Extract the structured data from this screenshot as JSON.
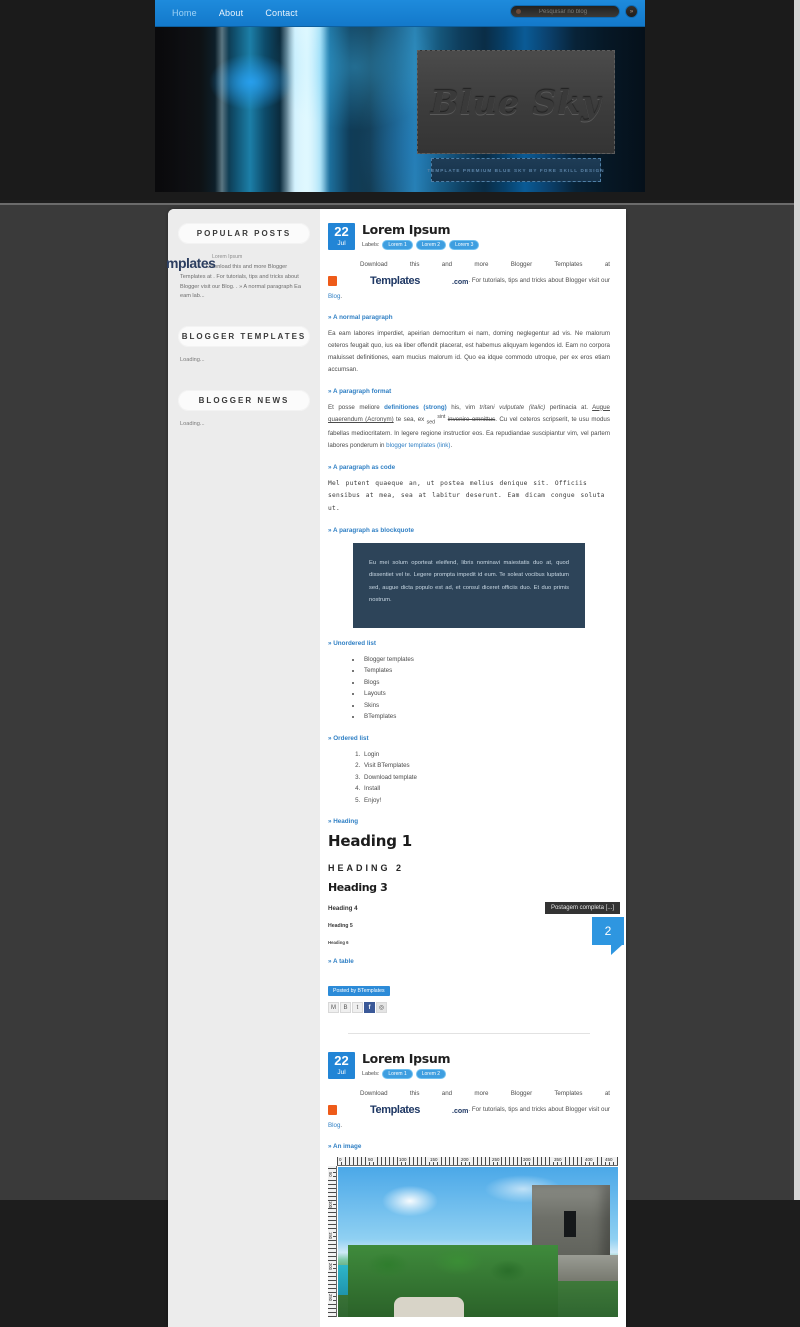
{
  "nav": {
    "items": [
      {
        "label": "Home",
        "active": true
      },
      {
        "label": "About",
        "active": false
      },
      {
        "label": "Contact",
        "active": false
      }
    ],
    "search": {
      "placeholder": "Pesquisar no blog",
      "value": "",
      "go_label": "»"
    }
  },
  "header": {
    "logo_text": "Blue Sky",
    "tagline": "TEMPLATE PREMIUM BLUE SKY BY FORE SKILL DESIGN"
  },
  "sidebar": {
    "widgets": [
      {
        "title": "POPULAR POSTS",
        "type": "popular",
        "watermark": "mplates",
        "item_title": "Lorem Ipsum",
        "item_snippet": "Download this and more Blogger Templates at . For tutorials, tips and tricks about Blogger visit our Blog. . » A normal paragraph Ea eam lab..."
      },
      {
        "title": "BLOGGER TEMPLATES",
        "type": "loading",
        "body": "Loading..."
      },
      {
        "title": "BLOGGER NEWS",
        "type": "loading",
        "body": "Loading..."
      }
    ]
  },
  "posts": [
    {
      "date_day": "22",
      "date_month": "Jul",
      "title": "Lorem Ipsum",
      "labels_word": "Labels:",
      "labels": [
        "Lorem 1",
        "Lorem 2",
        "Lorem 3"
      ],
      "intro_before": "Download this and more Blogger Templates at ",
      "intro_after_1": ". For tutorials, tips and tricks about Blogger visit our ",
      "intro_link": "Blog",
      "intro_end": ".",
      "btemplates": {
        "b": "B",
        "word": "Templates",
        "com": ".com"
      },
      "sections": {
        "normal_paragraph": "» A normal paragraph",
        "normal_paragraph_text": "Ea eam labores imperdiet, apeirian democritum ei nam, doming neglegentur ad vis. Ne malorum ceteros feugait quo, ius ea liber offendit placerat, est habemus aliquyam legendos id. Eam no corpora maluisset definitiones, eam mucius malorum id. Quo ea idque commodo utroque, per ex eros etiam accumsan.",
        "paragraph_format": "» A paragraph format",
        "fmt_1": "Et posse meliore ",
        "fmt_strong": "definitiones (strong)",
        "fmt_2": " his, vim ",
        "fmt_italic": "tritani vulputate (italic)",
        "fmt_3": " pertinacia at. ",
        "fmt_acronym": "Augue quaerendum (Acronym)",
        "fmt_4": " te sea, ex ",
        "fmt_sub": "sed",
        "fmt_sup": "sint",
        "fmt_strike": "invenire omnittus",
        "fmt_5": ". Cu vel ceteros scripserit, te usu modus fabellas mediocritatem. In legere regione instructior eos. Ea repudiandae suscipiantur vim, vel partem labores ponderum in ",
        "fmt_link": "blogger templates (link)",
        "fmt_6": ".",
        "paragraph_code": "» A paragraph as code",
        "code_text": "Mel putent quaeque an, ut postea melius denique sit. Officiis sensibus at mea, sea at labitur deserunt. Eam dicam congue soluta ut.",
        "paragraph_blockquote": "» A paragraph as blockquote",
        "blockquote_text": "Eu mei solum oporteat eleifend, libris nominavi maiestatis duo at, quod dissentiet vel te. Legere prompta impedit id eum. Te soleat vocibus luptatum sed, augue dicta populo est ad, et consul diceret officiis duo. Et duo primis nostrum.",
        "unordered_list": "» Unordered list",
        "ul_items": [
          "Blogger templates",
          "Templates",
          "Blogs",
          "Layouts",
          "Skins",
          "BTemplates"
        ],
        "ordered_list": "» Ordered list",
        "ol_items": [
          "Login",
          "Visit BTemplates",
          "Download template",
          "Install",
          "Enjoy!"
        ],
        "heading_label": "» Heading",
        "h1": "Heading 1",
        "h2": "HEADING 2",
        "h3": "Heading 3",
        "h4": "Heading 4",
        "h5": "Heading 5",
        "h6": "Heading 6",
        "a_table": "» A table"
      },
      "tooltip": "Postagem completa [...]",
      "posted_by": "Posted by BTemplates",
      "comment_count": "2",
      "share_icons": [
        "mail-icon",
        "blogger-icon",
        "twitter-icon",
        "facebook-icon",
        "pinterest-icon"
      ]
    },
    {
      "date_day": "22",
      "date_month": "Jul",
      "title": "Lorem Ipsum",
      "labels_word": "Labels:",
      "labels": [
        "Lorem 1",
        "Lorem 2"
      ],
      "intro_before": "Download this and more Blogger Templates at ",
      "intro_after_1": ". For tutorials, tips and tricks about Blogger visit our ",
      "intro_link": "Blog",
      "intro_end": ".",
      "btemplates": {
        "b": "B",
        "word": "Templates",
        "com": ".com"
      },
      "an_image": "» An image",
      "ruler_top_labels": [
        "0",
        "50",
        "100",
        "150",
        "200",
        "250",
        "300",
        "350",
        "400",
        "450"
      ],
      "ruler_left_labels": [
        "50",
        "100",
        "150",
        "200",
        "250"
      ]
    }
  ],
  "colors": {
    "accent_blue": "#2285d6",
    "nav_blue": "#1e8bdc",
    "link_blue": "#2f7fc4",
    "blockquote_bg": "#2d4459",
    "orange": "#ee5b19",
    "page_bg": "#1d1d1d",
    "sidebar_bg": "#ececec"
  }
}
